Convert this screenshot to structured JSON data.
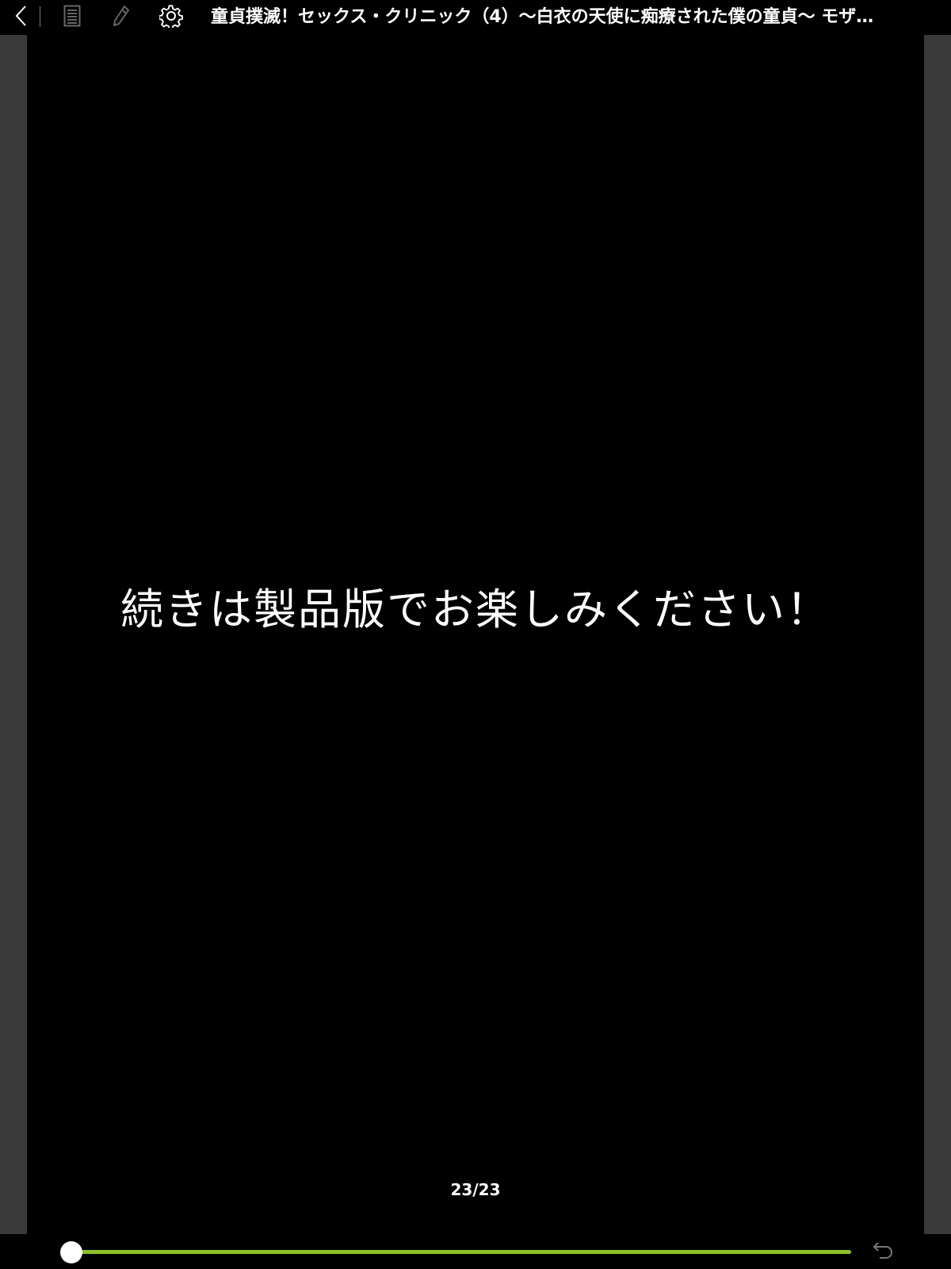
{
  "toolbar": {
    "back_icon": "chevron-left-icon",
    "toc_icon": "list-document-icon",
    "bookmark_icon": "pen-bookmark-icon",
    "settings_icon": "gear-icon",
    "title": "童貞撲滅！セックス・クリニック（4）〜白衣の天使に痴療された僕の童貞〜 モザ…"
  },
  "page": {
    "message": "続きは製品版でお楽しみください！"
  },
  "footer": {
    "page_counter": "23/23",
    "progress": 1.0,
    "accent_color": "#8fc31f",
    "return_icon": "return-arrow-icon"
  }
}
